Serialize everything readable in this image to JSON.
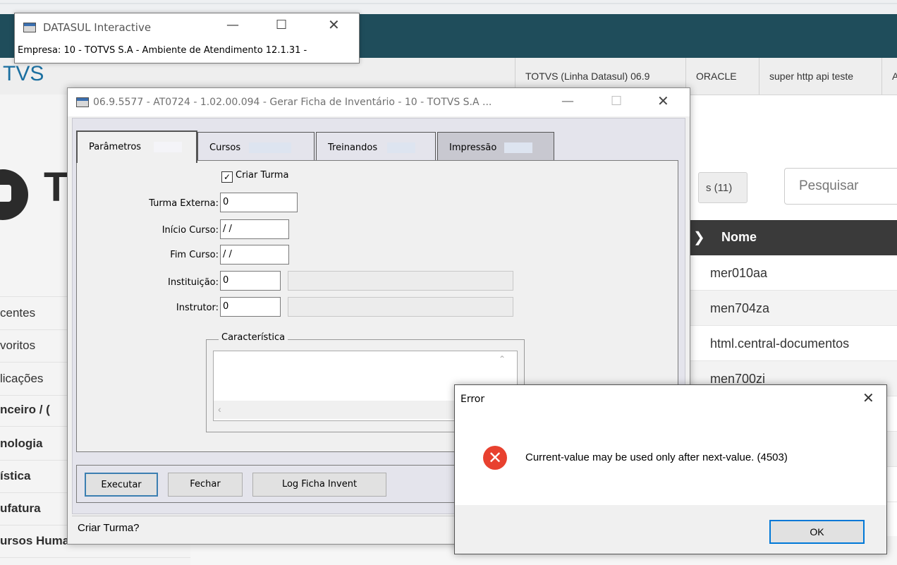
{
  "background": {
    "brand": "TVS",
    "menu": [
      "TOTVS (Linha Datasul) 06.9",
      "ORACLE",
      "super http api teste",
      "A"
    ],
    "logo_text": "T",
    "sidebar_items": [
      "centes",
      "voritos",
      "licações",
      "nceiro / (",
      "nologia",
      "ística",
      "ufatura",
      "ursos Humanos"
    ],
    "filter_label": "s  (11)",
    "search_placeholder": "Pesquisar",
    "table_header": "Nome",
    "table_rows": [
      "mer010aa",
      "men704za",
      "html.central-documentos",
      "men700zi"
    ]
  },
  "datasul_window": {
    "title": "DATASUL Interactive",
    "status": "Empresa: 10 - TOTVS S.A - Ambiente de Atendimento 12.1.31 -"
  },
  "main_dialog": {
    "title": "06.9.5577 - AT0724 - 1.02.00.094 - Gerar Ficha de Inventário - 10 - TOTVS S.A ...",
    "tabs": [
      "Parâmetros",
      "Cursos",
      "Treinandos",
      "Impressão"
    ],
    "checkbox_label": "Criar Turma",
    "checkbox_checked": true,
    "fields": {
      "turma_externa": {
        "label": "Turma Externa:",
        "value": "0"
      },
      "inicio_curso": {
        "label": "Início Curso:",
        "value": " / /"
      },
      "fim_curso": {
        "label": "Fim Curso:",
        "value": " / /"
      },
      "instituicao": {
        "label": "Instituição:",
        "value": "0"
      },
      "instrutor": {
        "label": "Instrutor:",
        "value": "0"
      }
    },
    "group_label": "Característica",
    "buttons": {
      "execute": "Executar",
      "close": "Fechar",
      "log": "Log Ficha Invent"
    },
    "status_text": "Criar Turma?"
  },
  "error_dialog": {
    "title": "Error",
    "message": "Current-value may be used only after next-value. (4503)",
    "ok_label": "OK"
  },
  "colors": {
    "header": "#1f4d5b",
    "error_icon": "#e8412f",
    "accent": "#0078d7"
  }
}
